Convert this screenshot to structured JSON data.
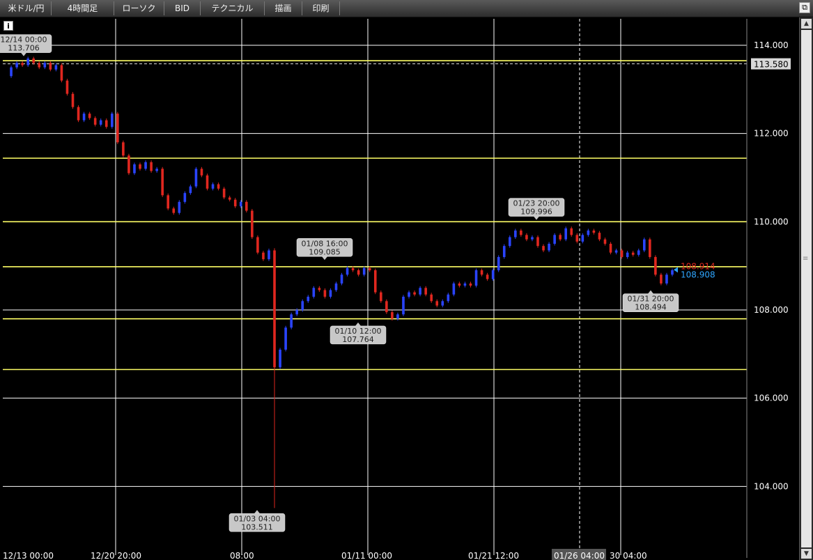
{
  "toolbar": {
    "items": [
      {
        "label": "米ドル/円"
      },
      {
        "label": "4時間足"
      },
      {
        "label": "ローソク"
      },
      {
        "label": "BID"
      },
      {
        "label": "テクニカル"
      },
      {
        "label": "描画"
      },
      {
        "label": "印刷"
      }
    ]
  },
  "icons": {
    "info": "i",
    "restore": "⧉",
    "scroll_up": "▲",
    "scroll_down": "▼",
    "grip": "≡"
  },
  "colors": {
    "up": "#2a44ff",
    "down": "#e0271f",
    "level_line": "#ffff66",
    "grid": "#ffffff",
    "annotation_bg": "#c8c8c8",
    "bid_price": "#e0271f",
    "ask_price": "#2fa6ff"
  },
  "chart_data": {
    "type": "candlestick",
    "ylim": [
      102.6,
      114.6
    ],
    "y_ticks": [
      "114.000",
      "112.000",
      "110.000",
      "108.000",
      "106.000",
      "104.000"
    ],
    "x_ticks": [
      "12/13 00:00",
      "12/20 20:00",
      "08:00",
      "01/11 00:00",
      "01/21 12:00",
      "01/26 04:00",
      "30 04:00"
    ],
    "current_price_label": "113.580",
    "current_price_value": 113.58,
    "bid_price": "108.914",
    "ask_price": "108.908",
    "last_price_value": 108.91,
    "horizontal_levels": [
      113.65,
      111.44,
      110.0,
      108.98,
      107.8,
      106.65
    ],
    "annotations": [
      {
        "time": "12/14 00:00",
        "price": "113.706",
        "position": "above"
      },
      {
        "time": "01/08 16:00",
        "price": "109.085",
        "position": "above"
      },
      {
        "time": "01/10 12:00",
        "price": "107.764",
        "position": "below"
      },
      {
        "time": "01/23 20:00",
        "price": "109.996",
        "position": "above"
      },
      {
        "time": "01/31 20:00",
        "price": "108.494",
        "position": "below"
      },
      {
        "time": "01/03 04:00",
        "price": "103.511",
        "position": "below"
      }
    ],
    "price_path": [
      113.3,
      113.5,
      113.6,
      113.55,
      113.7,
      113.6,
      113.5,
      113.6,
      113.45,
      113.55,
      113.2,
      112.9,
      112.6,
      112.3,
      112.45,
      112.35,
      112.2,
      112.3,
      112.15,
      112.45,
      111.8,
      111.5,
      111.1,
      111.3,
      111.2,
      111.35,
      111.15,
      111.2,
      110.6,
      110.3,
      110.2,
      110.45,
      110.65,
      110.8,
      111.2,
      111.05,
      110.75,
      110.85,
      110.75,
      110.55,
      110.5,
      110.35,
      110.45,
      110.25,
      109.65,
      109.3,
      109.15,
      109.35,
      106.7,
      107.1,
      107.6,
      107.9,
      108.0,
      108.2,
      108.3,
      108.5,
      108.45,
      108.3,
      108.45,
      108.6,
      108.8,
      108.95,
      108.9,
      108.8,
      108.95,
      108.9,
      108.4,
      108.2,
      107.95,
      107.8,
      107.9,
      108.3,
      108.4,
      108.35,
      108.5,
      108.35,
      108.2,
      108.1,
      108.2,
      108.35,
      108.6,
      108.55,
      108.6,
      108.55,
      108.9,
      108.8,
      108.7,
      108.9,
      109.2,
      109.45,
      109.65,
      109.8,
      109.7,
      109.6,
      109.65,
      109.45,
      109.35,
      109.5,
      109.7,
      109.6,
      109.85,
      109.7,
      109.55,
      109.7,
      109.8,
      109.75,
      109.6,
      109.5,
      109.3,
      109.35,
      109.2,
      109.3,
      109.25,
      109.35,
      109.6,
      109.2,
      108.8,
      108.6,
      108.8,
      108.9
    ]
  }
}
